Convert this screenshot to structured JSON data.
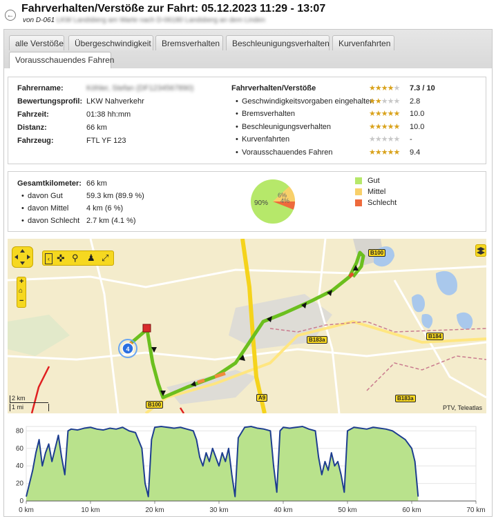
{
  "header": {
    "title": "Fahrverhalten/Verstöße zur Fahrt: 05.12.2023 11:29 - 13:07",
    "subtitle_prefix": "von D-061",
    "subtitle_blurred": "LKW Landsberg am Warte nach D-06180 Landsberg an dem Linden"
  },
  "tabs": [
    {
      "label": "alle Verstöße",
      "active": false
    },
    {
      "label": "Übergeschwindigkeit",
      "active": false
    },
    {
      "label": "Bremsverhalten",
      "active": false
    },
    {
      "label": "Beschleunigungsverhalten",
      "active": false
    },
    {
      "label": "Kurvenfahrten",
      "active": false
    },
    {
      "label": "Vorausschauendes Fahren",
      "active": true
    }
  ],
  "trip_info": {
    "fields": [
      {
        "label": "Fahrername:",
        "value": "Köhler, Stefan (DF1234567890)",
        "blurred": true
      },
      {
        "label": "Bewertungsprofil:",
        "value": "LKW Nahverkehr",
        "blurred": false
      },
      {
        "label": "Fahrzeit:",
        "value": "01:38 hh:mm",
        "blurred": false
      },
      {
        "label": "Distanz:",
        "value": "66 km",
        "blurred": false
      },
      {
        "label": "Fahrzeug:",
        "value": "FTL YF 123",
        "blurred": false
      }
    ]
  },
  "ratings": {
    "heading": "Fahrverhalten/Verstöße",
    "overall_stars": 3.5,
    "overall_score": "7.3 / 10",
    "items": [
      {
        "label": "Geschwindigkeitsvorgaben eingehalten",
        "stars": 1.5,
        "score": "2.8"
      },
      {
        "label": "Bremsverhalten",
        "stars": 5,
        "score": "10.0"
      },
      {
        "label": "Beschleunigungsverhalten",
        "stars": 5,
        "score": "10.0"
      },
      {
        "label": "Kurvenfahrten",
        "stars": 0,
        "score": "-"
      },
      {
        "label": "Vorausschauendes Fahren",
        "stars": 4.5,
        "score": "9.4"
      }
    ]
  },
  "distance": {
    "total_label": "Gesamtkilometer:",
    "total_value": "66 km",
    "rows": [
      {
        "label": "davon Gut",
        "value": "59.3 km (89.9 %)"
      },
      {
        "label": "davon Mittel",
        "value": "4 km (6 %)"
      },
      {
        "label": "davon Schlecht",
        "value": "2.7 km (4.1 %)"
      }
    ],
    "pie_labels": {
      "gut": "90%",
      "mittel": "6%",
      "schlecht": "4%"
    },
    "legend": [
      {
        "label": "Gut",
        "color": "#b6e86a"
      },
      {
        "label": "Mittel",
        "color": "#f8d06a"
      },
      {
        "label": "Schlecht",
        "color": "#ee6a3c"
      }
    ]
  },
  "map": {
    "road_labels": [
      "B100",
      "B183a",
      "B184",
      "B100",
      "A9",
      "B183a"
    ],
    "scale_km": "2 km",
    "scale_mi": "1 mi",
    "attribution": "PTV, Teleatlas",
    "cluster_count": "4",
    "icons": [
      "pan-icon",
      "back-icon",
      "select-icon",
      "zoom-icon",
      "person-icon",
      "fullscreen-icon",
      "zoom-in-icon",
      "home-icon",
      "zoom-out-icon",
      "layers-icon"
    ]
  },
  "chart_data": {
    "type": "area",
    "x_ticks": [
      "0 km",
      "10 km",
      "20 km",
      "30 km",
      "40 km",
      "50 km",
      "60 km",
      "70 km"
    ],
    "y_ticks": [
      "0",
      "20",
      "40",
      "60",
      "80"
    ],
    "xlim": [
      0,
      70
    ],
    "ylim": [
      0,
      85
    ],
    "fill_color": "#b9e28c",
    "line_color": "#1d3d8f",
    "x": [
      0,
      0.5,
      1,
      1.5,
      2,
      2.5,
      3,
      3.5,
      4,
      4.5,
      5,
      5.5,
      6,
      6.5,
      7,
      8,
      9,
      10,
      11,
      12,
      13,
      14,
      15,
      16,
      17,
      18,
      18.5,
      19,
      19.5,
      20,
      21,
      22,
      23,
      24,
      25,
      26,
      26.5,
      27,
      27.5,
      28,
      28.5,
      29,
      29.5,
      30,
      30.5,
      31,
      31.5,
      32,
      32.5,
      33,
      34,
      35,
      36,
      37,
      38,
      38.5,
      39,
      39.5,
      40,
      41,
      42,
      43,
      44,
      45,
      45.5,
      46,
      46.5,
      47,
      47.5,
      48,
      48.5,
      49,
      49.5,
      50,
      51,
      52,
      53,
      54,
      55,
      56,
      57,
      58,
      59,
      60,
      60.5,
      61
    ],
    "y": [
      5,
      20,
      35,
      55,
      70,
      40,
      55,
      65,
      45,
      60,
      75,
      50,
      30,
      80,
      82,
      81,
      83,
      84,
      82,
      81,
      83,
      82,
      84,
      80,
      78,
      60,
      20,
      5,
      70,
      84,
      85,
      84,
      83,
      84,
      82,
      80,
      70,
      50,
      40,
      55,
      45,
      60,
      50,
      40,
      55,
      45,
      60,
      30,
      5,
      72,
      84,
      85,
      83,
      82,
      80,
      40,
      10,
      80,
      84,
      83,
      84,
      85,
      82,
      80,
      50,
      30,
      45,
      35,
      55,
      40,
      45,
      30,
      10,
      80,
      84,
      83,
      82,
      84,
      83,
      82,
      80,
      75,
      70,
      60,
      45,
      5
    ]
  }
}
